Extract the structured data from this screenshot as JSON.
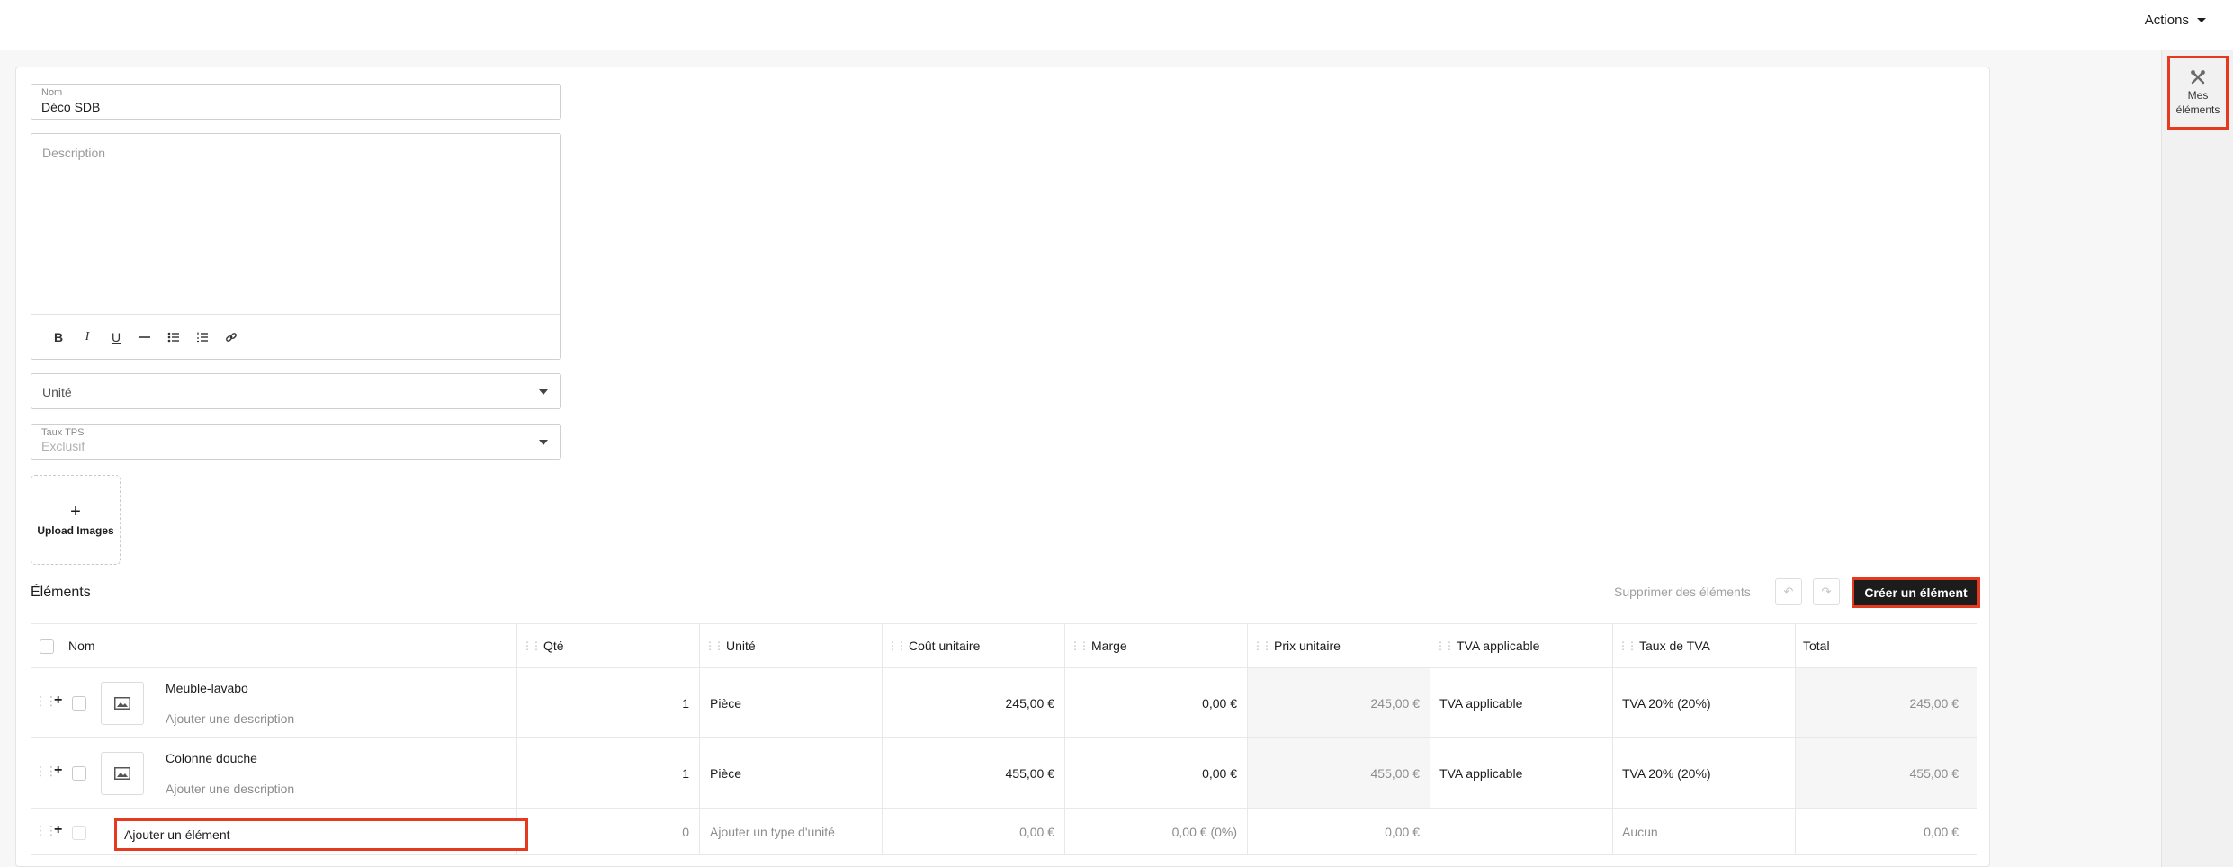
{
  "topbar": {
    "actions_label": "Actions"
  },
  "rail": {
    "mes_elements_line1": "Mes",
    "mes_elements_line2": "éléments"
  },
  "form": {
    "name_label": "Nom",
    "name_value": "Déco SDB",
    "description_placeholder": "Description",
    "unite_placeholder": "Unité",
    "tps_label": "Taux TPS",
    "tps_value": "Exclusif",
    "upload_label": "Upload Images"
  },
  "elements": {
    "title": "Éléments",
    "delete_label": "Supprimer des éléments",
    "create_label": "Créer un élément",
    "columns": {
      "nom": "Nom",
      "qte": "Qté",
      "unite": "Unité",
      "cout": "Coût unitaire",
      "marge": "Marge",
      "prix": "Prix unitaire",
      "tva_app": "TVA applicable",
      "taux": "Taux de TVA",
      "total": "Total"
    },
    "rows": [
      {
        "name": "Meuble-lavabo",
        "description": "Ajouter une description",
        "qte": "1",
        "unite": "Pièce",
        "cout": "245,00 €",
        "marge": "0,00 €",
        "prix": "245,00 €",
        "tva_app": "TVA applicable",
        "taux": "TVA 20% (20%)",
        "total": "245,00 €"
      },
      {
        "name": "Colonne douche",
        "description": "Ajouter une description",
        "qte": "1",
        "unite": "Pièce",
        "cout": "455,00 €",
        "marge": "0,00 €",
        "prix": "455,00 €",
        "tva_app": "TVA applicable",
        "taux": "TVA 20% (20%)",
        "total": "455,00 €"
      }
    ],
    "add_row": {
      "placeholder": "Ajouter un élément",
      "qte": "0",
      "unite": "Ajouter un type d'unité",
      "cout": "0,00 €",
      "marge": "0,00 € (0%)",
      "prix": "0,00 €",
      "taux": "Aucun",
      "total": "0,00 €"
    }
  },
  "colors": {
    "highlight": "#e53a1f",
    "primary_button": "#1c1c1c"
  }
}
